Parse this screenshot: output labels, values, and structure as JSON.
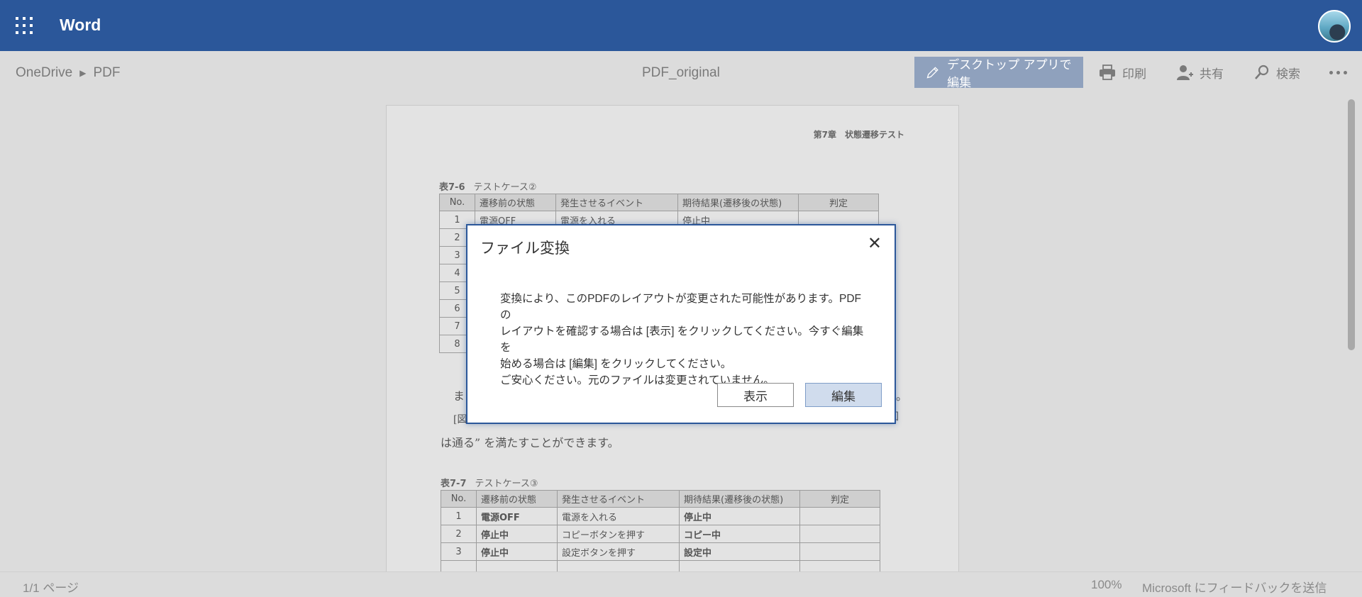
{
  "app": {
    "name": "Word"
  },
  "breadcrumb": {
    "root": "OneDrive",
    "folder": "PDF"
  },
  "document": {
    "title": "PDF_original"
  },
  "commands": {
    "edit_desktop": "デスクトップ アプリで編集",
    "print": "印刷",
    "share": "共有",
    "search": "検索"
  },
  "page": {
    "chapter": "第7章　状態遷移テスト",
    "table1": {
      "caption_num": "表7-6",
      "caption_title": "テストケース②",
      "headers": [
        "No.",
        "遷移前の状態",
        "発生させるイベント",
        "期待結果(遷移後の状態)",
        "判定"
      ],
      "rows": [
        [
          "1",
          "電源OFF",
          "電源を入れる",
          "停止中",
          ""
        ],
        [
          "2",
          "",
          "",
          "",
          ""
        ],
        [
          "3",
          "",
          "",
          "",
          ""
        ],
        [
          "4",
          "",
          "",
          "",
          ""
        ],
        [
          "5",
          "",
          "",
          "",
          ""
        ],
        [
          "6",
          "",
          "",
          "",
          ""
        ],
        [
          "7",
          "",
          "",
          "",
          ""
        ],
        [
          "8",
          "",
          "",
          "",
          ""
        ]
      ]
    },
    "para_line1": "ま",
    "para_line2": "[図",
    "para_line3": "は通る” を満たすことができます。",
    "para_tail1": "。",
    "para_tail2": "回",
    "table2": {
      "caption_num": "表7-7",
      "caption_title": "テストケース③",
      "headers": [
        "No.",
        "遷移前の状態",
        "発生させるイベント",
        "期待結果(遷移後の状態)",
        "判定"
      ],
      "rows": [
        [
          "1",
          "電源OFF",
          "電源を入れる",
          "停止中",
          ""
        ],
        [
          "2",
          "停止中",
          "コピーボタンを押す",
          "コピー中",
          ""
        ],
        [
          "3",
          "停止中",
          "設定ボタンを押す",
          "設定中",
          ""
        ]
      ]
    }
  },
  "dialog": {
    "title": "ファイル変換",
    "body_lines": [
      "変換により、このPDFのレイアウトが変更された可能性があります。PDFの",
      "レイアウトを確認する場合は [表示] をクリックしてください。今すぐ編集を",
      "始める場合は [編集] をクリックしてください。",
      "ご安心ください。元のファイルは変更されていません。"
    ],
    "view_button": "表示",
    "edit_button": "編集"
  },
  "status": {
    "page_count": "1/1 ページ",
    "zoom": "100%",
    "feedback": "Microsoft にフィードバックを送信"
  },
  "colors": {
    "brand": "#2b579a",
    "edit_button_bg": "#8fa1bd"
  }
}
